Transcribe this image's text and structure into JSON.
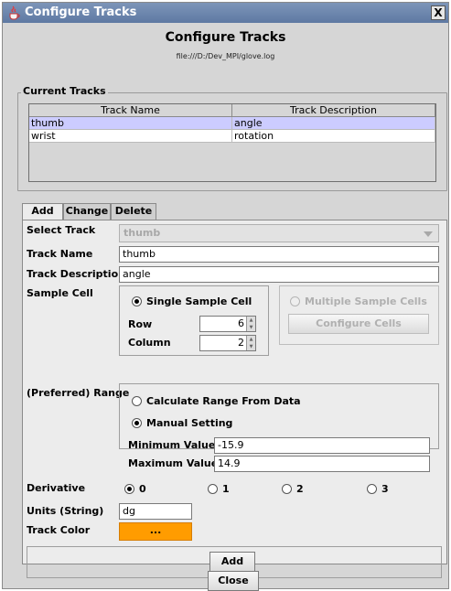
{
  "window": {
    "title": "Configure Tracks",
    "close_glyph": "X"
  },
  "heading": "Configure Tracks",
  "file_path": "file:///D:/Dev_MPI/glove.log",
  "current_tracks": {
    "title": "Current Tracks",
    "columns": [
      "Track Name",
      "Track Description"
    ],
    "rows": [
      {
        "name": "thumb",
        "description": "angle"
      },
      {
        "name": "wrist",
        "description": "rotation"
      }
    ]
  },
  "tabs": [
    {
      "label": "Add"
    },
    {
      "label": "Change"
    },
    {
      "label": "Delete"
    }
  ],
  "form": {
    "select_track_label": "Select Track",
    "select_track_value": "thumb",
    "track_name_label": "Track Name",
    "track_name_value": "thumb",
    "track_description_label": "Track Description",
    "track_description_value": "angle",
    "sample_cell_label": "Sample Cell",
    "single_sample_label": "Single Sample Cell",
    "multiple_sample_label": "Multiple Sample Cells",
    "row_label": "Row",
    "row_value": "6",
    "column_label": "Column",
    "column_value": "2",
    "configure_cells_label": "Configure Cells",
    "range_label": "(Preferred) Range",
    "calc_range_label": "Calculate Range From Data",
    "manual_setting_label": "Manual Setting",
    "min_label": "Minimum Value",
    "min_value": "-15.9",
    "max_label": "Maximum Value",
    "max_value": "14.9",
    "derivative_label": "Derivative",
    "derivative_options": [
      "0",
      "1",
      "2",
      "3"
    ],
    "units_label": "Units (String)",
    "units_value": "dg",
    "track_color_label": "Track Color",
    "track_color_button": "...",
    "track_color": "#ff9c00",
    "add_button": "Add"
  },
  "close_button": "Close"
}
